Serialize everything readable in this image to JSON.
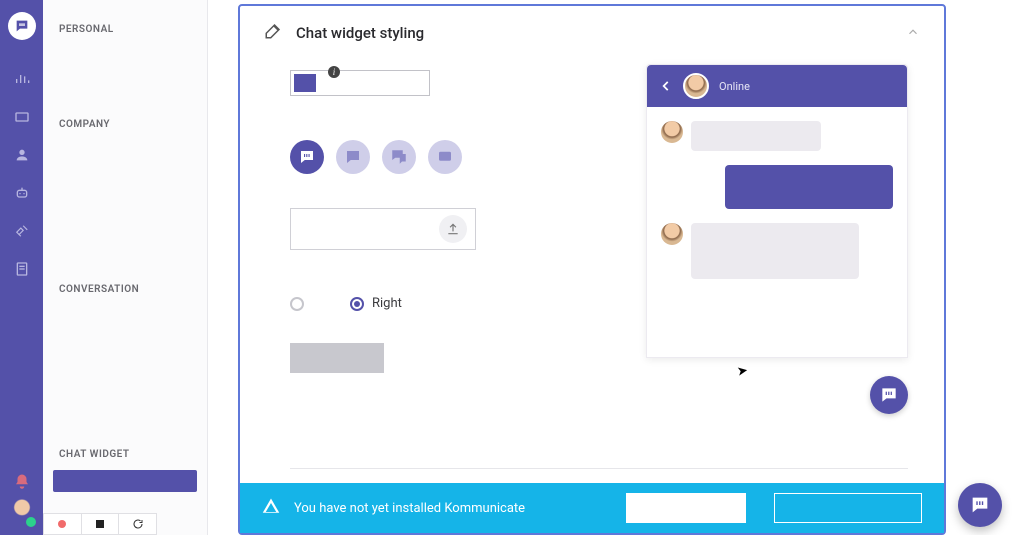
{
  "brand": {
    "accent": "#5451a9",
    "banner": "#15b4e8"
  },
  "rail": {
    "icons": [
      "chart",
      "chat",
      "user",
      "bot",
      "expand",
      "doc"
    ]
  },
  "sidebar": {
    "sections": {
      "personal": "PERSONAL",
      "company": "COMPANY",
      "conversation": "CONVERSATION",
      "chatwidget": "CHAT WIDGET"
    }
  },
  "card": {
    "title": "Chat widget styling",
    "color_value": "#5451a9",
    "position": {
      "left_label": "",
      "right_label": "Right",
      "selected": "right"
    }
  },
  "preview": {
    "status": "Online"
  },
  "banner": {
    "text": "You have not yet installed Kommunicate"
  }
}
